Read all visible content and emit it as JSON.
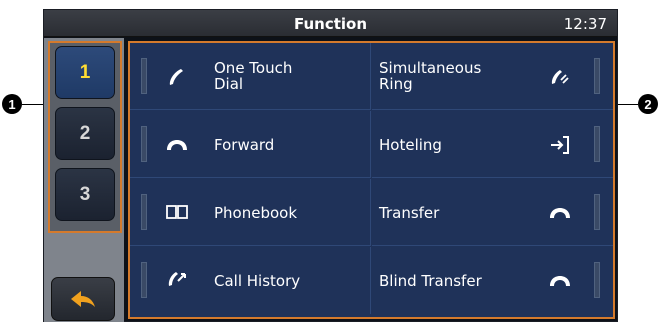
{
  "header": {
    "title": "Function",
    "clock": "12:37"
  },
  "sidebar": {
    "pages": [
      {
        "label": "1",
        "active": true
      },
      {
        "label": "2",
        "active": false
      },
      {
        "label": "3",
        "active": false
      }
    ],
    "back_icon": "back-arrow-icon"
  },
  "functions": {
    "left": [
      {
        "line1": "One Touch",
        "line2": "Dial",
        "icon": "handset-icon"
      },
      {
        "line1": "Forward",
        "line2": "",
        "icon": "forward-handset-icon"
      },
      {
        "line1": "Phonebook",
        "line2": "",
        "icon": "book-icon"
      },
      {
        "line1": "Call History",
        "line2": "",
        "icon": "call-history-icon"
      }
    ],
    "right": [
      {
        "line1": "Simultaneous",
        "line2": "Ring",
        "icon": "simultaneous-ring-icon"
      },
      {
        "line1": "Hoteling",
        "line2": "",
        "icon": "login-arrow-icon"
      },
      {
        "line1": "Transfer",
        "line2": "",
        "icon": "transfer-handset-icon"
      },
      {
        "line1": "Blind Transfer",
        "line2": "",
        "icon": "blind-transfer-icon"
      }
    ]
  },
  "callouts": {
    "left": "1",
    "right": "2"
  },
  "colors": {
    "highlight": "#d47a2c",
    "grid_bg": "#1f3259",
    "active_page": "#ffdd33",
    "back_arrow": "#f0a11e"
  }
}
